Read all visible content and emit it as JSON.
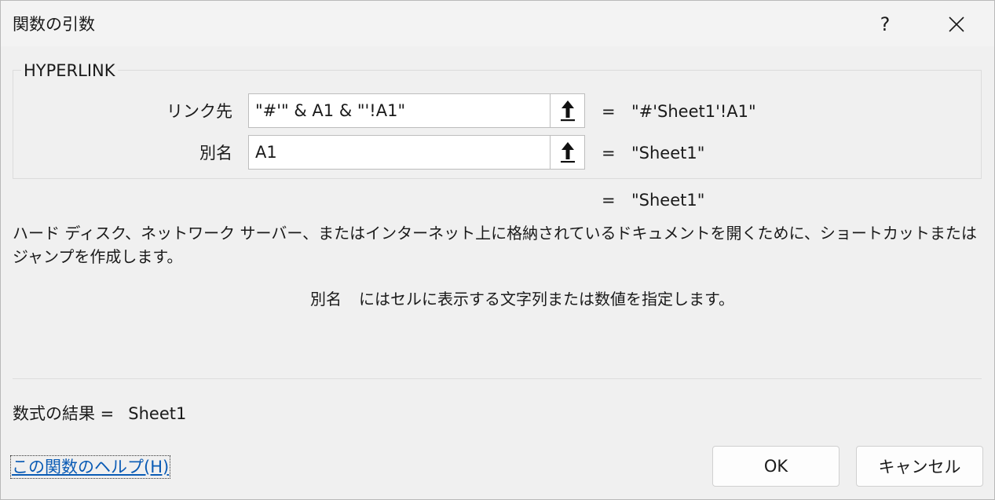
{
  "window": {
    "title": "関数の引数",
    "help_label": "?",
    "close_icon": "close-icon"
  },
  "function": {
    "name": "HYPERLINK"
  },
  "arguments": [
    {
      "label": "リンク先",
      "value": "\"#'\" & A1 & \"'!A1\"",
      "equals": "=",
      "result": "\"#'Sheet1'!A1\"",
      "collapse_icon": "collapse-arrow-up-icon"
    },
    {
      "label": "別名",
      "value": "A1",
      "equals": "=",
      "result": "\"Sheet1\"",
      "collapse_icon": "collapse-arrow-up-icon"
    }
  ],
  "function_result": {
    "equals": "=",
    "value": "\"Sheet1\""
  },
  "description": "ハード ディスク、ネットワーク サーバー、またはインターネット上に格納されているドキュメントを開くために、ショートカットまたはジャンプを作成します。",
  "argument_description": {
    "name": "別名",
    "text": "にはセルに表示する文字列または数値を指定します。"
  },
  "formula_result": {
    "label": "数式の結果 =",
    "value": "Sheet1"
  },
  "help_link": "この関数のヘルプ(H)",
  "buttons": {
    "ok": "OK",
    "cancel": "キャンセル"
  }
}
